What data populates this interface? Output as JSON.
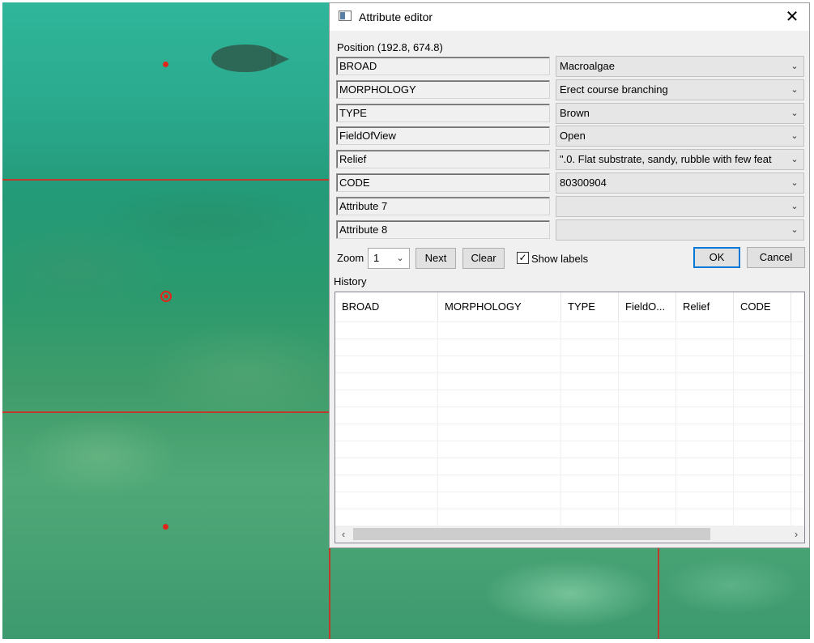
{
  "dialog": {
    "title": "Attribute editor",
    "position_label": "Position (192.8, 674.8)",
    "attributes": [
      {
        "name": "BROAD",
        "value": "Macroalgae"
      },
      {
        "name": "MORPHOLOGY",
        "value": "Erect course branching"
      },
      {
        "name": "TYPE",
        "value": "Brown"
      },
      {
        "name": "FieldOfView",
        "value": "Open"
      },
      {
        "name": "Relief",
        "value": "\".0. Flat substrate, sandy, rubble with few feat"
      },
      {
        "name": "CODE",
        "value": "80300904"
      },
      {
        "name": "Attribute 7",
        "value": ""
      },
      {
        "name": "Attribute 8",
        "value": ""
      }
    ],
    "zoom_label": "Zoom",
    "zoom_value": "1",
    "next_label": "Next",
    "clear_label": "Clear",
    "show_labels": {
      "label": "Show labels",
      "checked": true
    },
    "ok_label": "OK",
    "cancel_label": "Cancel",
    "history_label": "History",
    "history_columns": [
      "BROAD",
      "MORPHOLOGY",
      "TYPE",
      "FieldO...",
      "Relief",
      "CODE"
    ],
    "history_rows": [],
    "icons": {
      "close": "close-icon",
      "dropdown": "chevron-down-icon",
      "scroll_left": "chevron-left-icon",
      "scroll_right": "chevron-right-icon",
      "app": "window-icon"
    }
  },
  "colors": {
    "annotation_red": "#e0261b",
    "ok_border": "#0078d7"
  }
}
